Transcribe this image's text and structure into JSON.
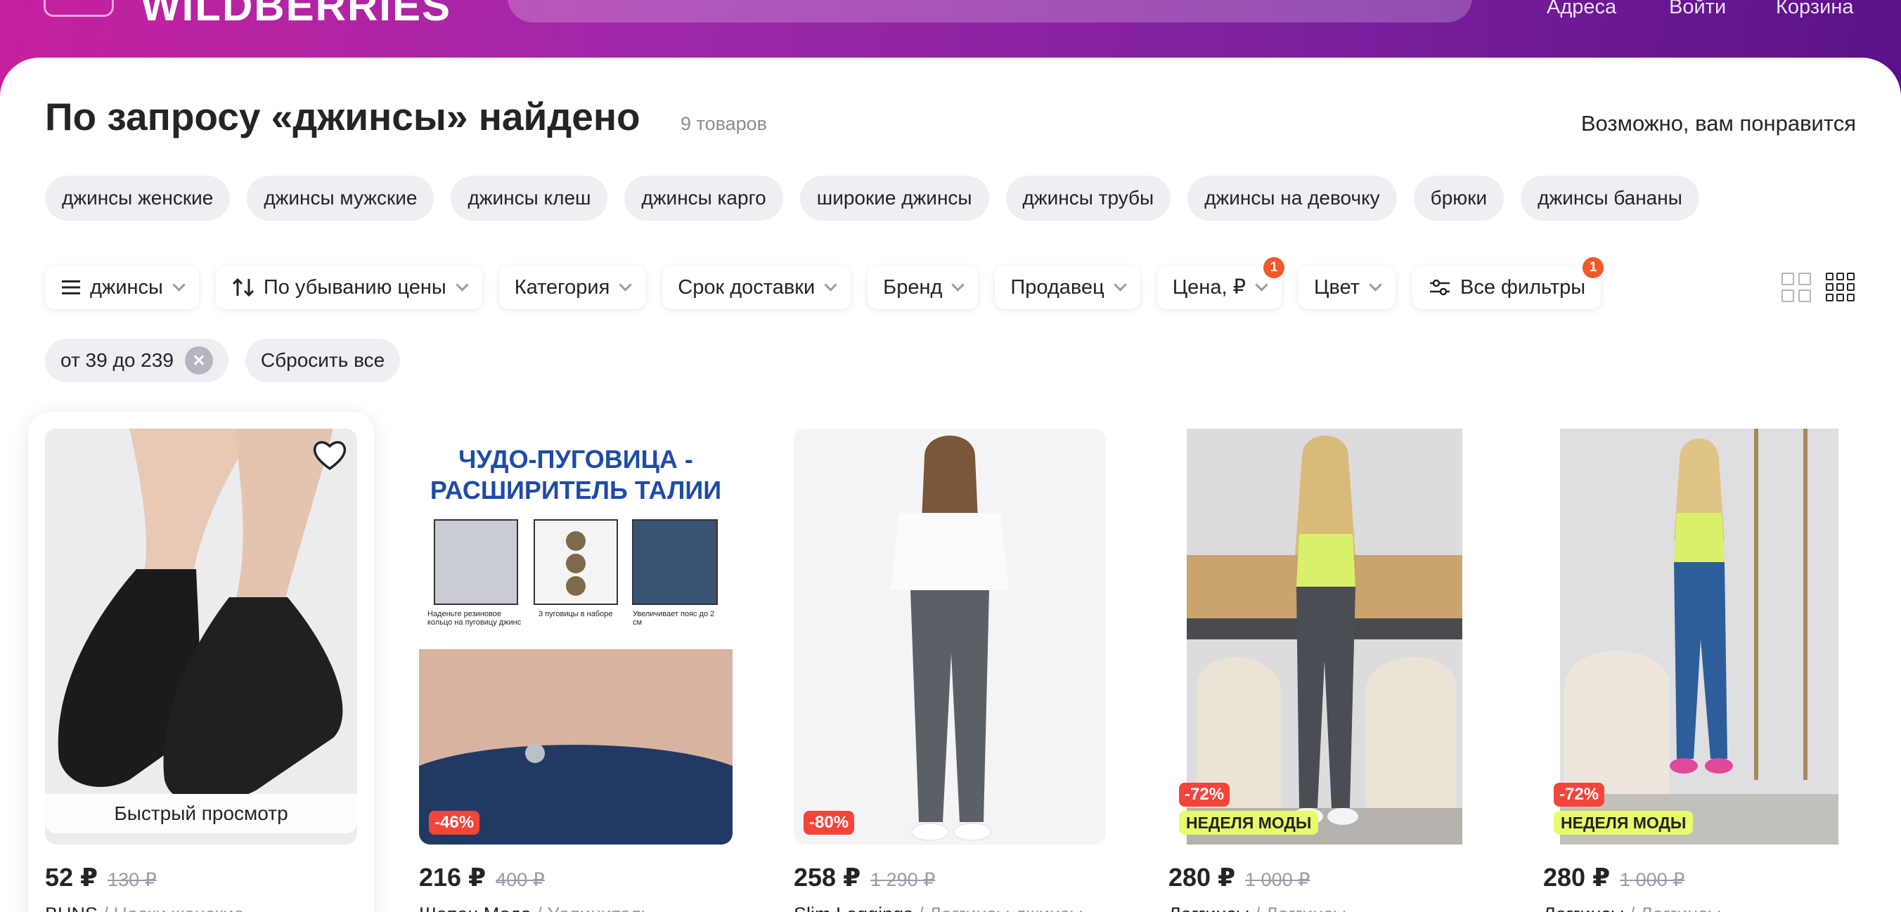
{
  "header": {
    "logo_text": "WILDBERRIES",
    "nav": [
      "Адреса",
      "Войти",
      "Корзина"
    ]
  },
  "results": {
    "title": "По запросу «джинсы» найдено",
    "count": "9 товаров",
    "recommend": "Возможно, вам понравится"
  },
  "suggestions": [
    "джинсы женские",
    "джинсы мужские",
    "джинсы клеш",
    "джинсы карго",
    "широкие джинсы",
    "джинсы трубы",
    "джинсы на девочку",
    "брюки",
    "джинсы бананы"
  ],
  "filters": {
    "category_query": "джинсы",
    "sort": "По убыванию цены",
    "category": "Категория",
    "delivery": "Срок доставки",
    "brand": "Бренд",
    "seller": "Продавец",
    "price": "Цена, ₽",
    "price_badge": "1",
    "color": "Цвет",
    "all": "Все фильтры",
    "all_badge": "1"
  },
  "applied": {
    "price_range": "от 39 до 239",
    "reset": "Сбросить все"
  },
  "products": [
    {
      "price": "52 ₽",
      "old_price": "130 ₽",
      "brand": "BUNS",
      "name": "/ Носки женские",
      "quick_view": "Быстрый просмотр"
    },
    {
      "price": "216 ₽",
      "old_price": "400 ₽",
      "brand": "Шопен Мода",
      "name": "/ Удлинитель",
      "discount": "-46%",
      "promo_line1": "ЧУДО-ПУГОВИЦА -",
      "promo_line2": "РАСШИРИТЕЛЬ ТАЛИИ",
      "captions": [
        "Наденьте резиновое кольцо на пуговицу джинс",
        "3 пуговицы в наборе",
        "Увеличивает пояс до 2 см"
      ]
    },
    {
      "price": "258 ₽",
      "old_price": "1 290 ₽",
      "brand": "Slim Leggings",
      "name": "/ Леггинсы джинсы",
      "discount": "-80%"
    },
    {
      "price": "280 ₽",
      "old_price": "1 000 ₽",
      "brand": "Леггинсы",
      "name": "/ Леггинсы",
      "discount": "-72%",
      "tag": "НЕДЕЛЯ МОДЫ"
    },
    {
      "price": "280 ₽",
      "old_price": "1 000 ₽",
      "brand": "Леггинсы",
      "name": "/ Леггинсы",
      "discount": "-72%",
      "tag": "НЕДЕЛЯ МОДЫ"
    }
  ],
  "colors": {
    "accent": "#a526a5",
    "badge": "#f1592a",
    "discount": "#f5443a",
    "fashion_tag": "#e7fb6c"
  }
}
